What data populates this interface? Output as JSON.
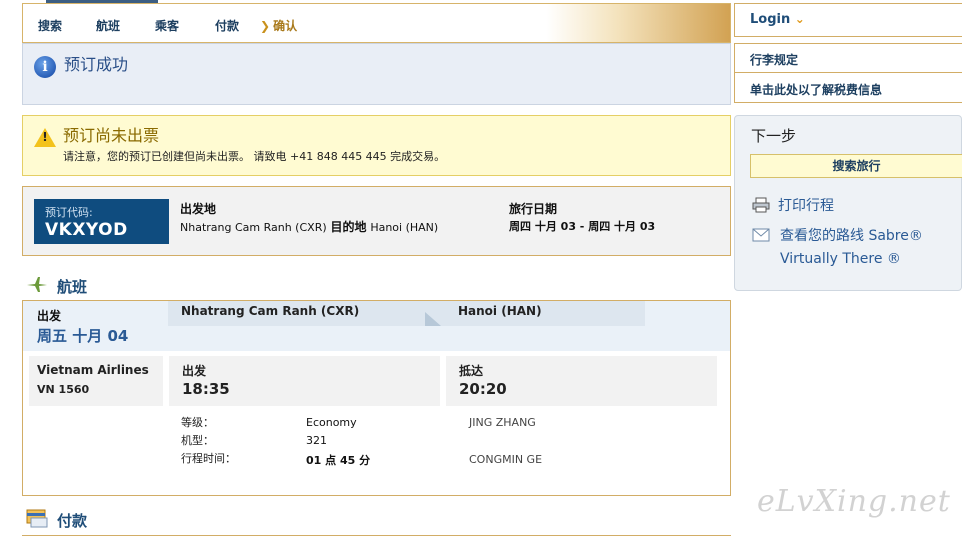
{
  "nav": {
    "steps": [
      "搜索",
      "航班",
      "乘客",
      "付款",
      "确认"
    ],
    "active_step": "确认"
  },
  "success": {
    "title": "预订成功"
  },
  "warning": {
    "title": "预订尚未出票",
    "text": "请注意，您的预订已创建但尚未出票。 请致电 +41 848 445 445 完成交易。"
  },
  "summary": {
    "code_label": "预订代码:",
    "code_value": "VKXYOD",
    "origin_label": "出发地",
    "origin_value": "Nhatrang Cam Ranh  (CXR)",
    "dest_label": "目的地",
    "dest_value": "Hanoi  (HAN)",
    "date_label": "旅行日期",
    "date_value": "周四  十月  03 - 周四  十月  03"
  },
  "flights_section": {
    "title": "航班"
  },
  "flight": {
    "depart_label": "出发",
    "date": "周五  十月  04",
    "route_from": "Nhatrang Cam Ranh (CXR)",
    "route_to": "Hanoi (HAN)",
    "airline": "Vietnam Airlines",
    "flight_no": "VN 1560",
    "dep_label": "出发",
    "dep_time": "18:35",
    "arr_label": "抵达",
    "arr_time": "20:20",
    "class_label": "等级：",
    "class_value": "Economy",
    "aircraft_label": "机型：",
    "aircraft_value": "321",
    "duration_label": "行程时间：",
    "duration_value": "01 点  45 分",
    "passengers": [
      "JING ZHANG",
      "CONGMIN GE"
    ]
  },
  "payment_section": {
    "title": "付款"
  },
  "sidebar": {
    "login": "Login",
    "links": [
      "行李规定",
      "单击此处以了解税费信息"
    ],
    "next_title": "下一步",
    "search_button": "搜索旅行",
    "print_link": "打印行程",
    "view_link_line1": "查看您的路线  Sabre®",
    "view_link_line2": "Virtually There ®"
  },
  "watermark": "eLvXing.net",
  "colors": {
    "navy": "#1f4d78",
    "gold_border": "#d2ad66",
    "code_bg": "#0f4c7f",
    "warning_bg": "#fffbd2",
    "info_bg": "#e9eef6"
  }
}
